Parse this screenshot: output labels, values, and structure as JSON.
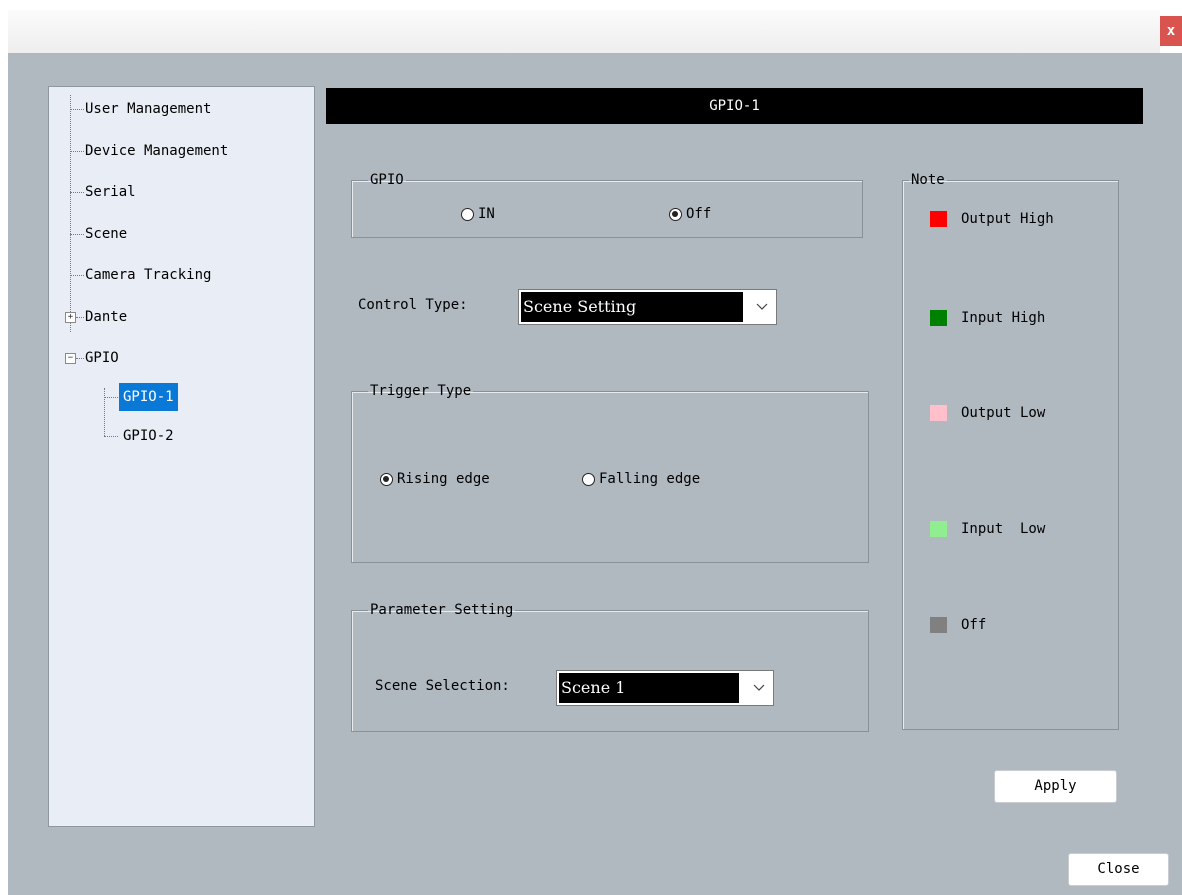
{
  "window": {
    "close_glyph": "x"
  },
  "tree": {
    "items": [
      {
        "label": "User Management"
      },
      {
        "label": "Device Management"
      },
      {
        "label": "Serial"
      },
      {
        "label": "Scene"
      },
      {
        "label": "Camera Tracking"
      },
      {
        "label": "Dante",
        "expander": "+"
      },
      {
        "label": "GPIO",
        "expander": "−"
      },
      {
        "label": "GPIO-1",
        "selected": true
      },
      {
        "label": "GPIO-2"
      }
    ]
  },
  "panel": {
    "title": "GPIO-1",
    "gpio_group": {
      "legend": "GPIO",
      "option_in": "IN",
      "option_off": "Off",
      "selected": "Off"
    },
    "control_type": {
      "label": "Control Type:",
      "value": "Scene Setting"
    },
    "trigger_group": {
      "legend": "Trigger Type",
      "option_rising": "Rising edge",
      "option_falling": "Falling edge",
      "selected": "Rising edge"
    },
    "parameter_group": {
      "legend": "Parameter Setting",
      "scene_label": "Scene Selection:",
      "scene_value": "Scene 1"
    },
    "note_group": {
      "legend": "Note",
      "items": [
        {
          "label": "Output High",
          "color": "#ff0000"
        },
        {
          "label": "Input High",
          "color": "#008000"
        },
        {
          "label": "Output Low",
          "color": "#ffc0cb"
        },
        {
          "label": "Input  Low",
          "color": "#90ee90"
        },
        {
          "label": "Off",
          "color": "#808080"
        }
      ]
    },
    "apply_label": "Apply"
  },
  "footer": {
    "close_label": "Close"
  }
}
